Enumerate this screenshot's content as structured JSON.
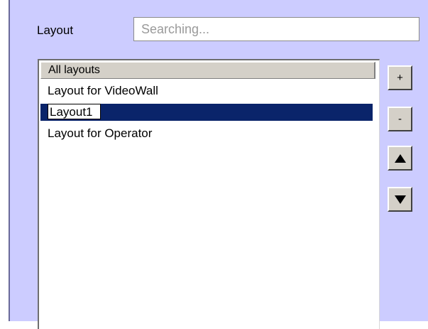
{
  "layout_panel": {
    "label": "Layout",
    "search": {
      "value": "",
      "placeholder": "Searching..."
    },
    "list": {
      "header": "All layouts",
      "items": [
        {
          "label": "Layout for VideoWall",
          "selected": false,
          "editing": false
        },
        {
          "label": "Layout1",
          "selected": true,
          "editing": true
        },
        {
          "label": "Layout for Operator",
          "selected": false,
          "editing": false
        }
      ]
    },
    "buttons": {
      "add": "+",
      "remove": "-",
      "move_up_icon": "triangle-up-icon",
      "move_down_icon": "triangle-down-icon"
    }
  },
  "colors": {
    "panel_background": "#ccccff",
    "selection": "#0a246a",
    "button_face": "#d4d0c8"
  }
}
